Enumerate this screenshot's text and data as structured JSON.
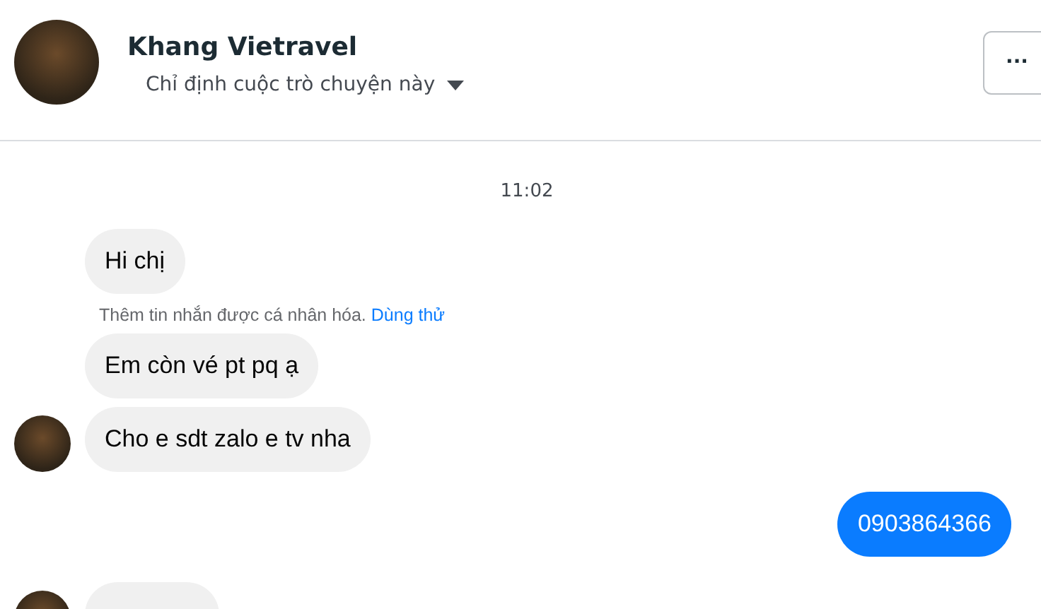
{
  "header": {
    "name": "Khang Vietravel",
    "subtitle": "Chỉ định cuộc trò chuyện này",
    "more_button": "···"
  },
  "thread": [
    {
      "kind": "time",
      "text": "11:02"
    },
    {
      "kind": "incoming",
      "text": "Hi chị",
      "avatar": false
    },
    {
      "kind": "notice",
      "text": "Thêm tin nhắn được cá nhân hóa.",
      "link": "Dùng thử"
    },
    {
      "kind": "incoming",
      "text": "Em còn vé pt pq ạ",
      "avatar": false
    },
    {
      "kind": "incoming",
      "text": "Cho e sdt zalo e tv nha",
      "avatar": true
    },
    {
      "kind": "outgoing",
      "text": "0903864366"
    },
    {
      "kind": "incoming",
      "avatar": true
    }
  ]
}
